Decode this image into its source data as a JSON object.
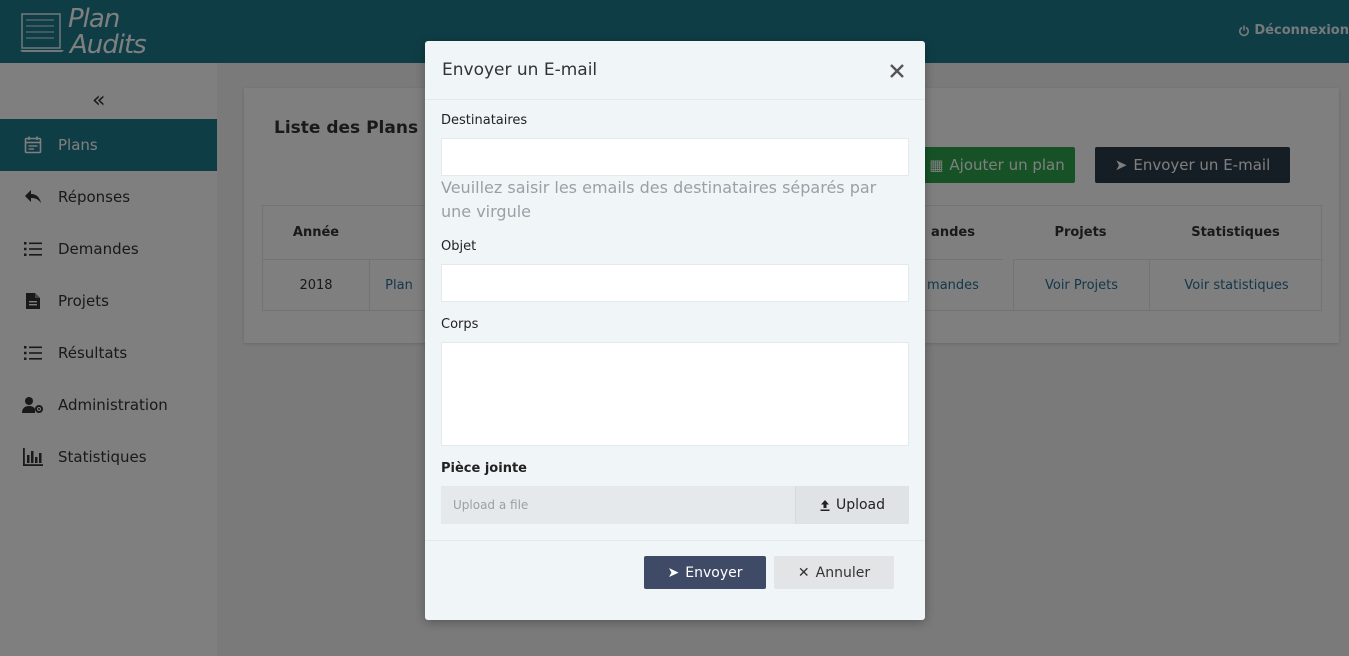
{
  "app": {
    "logo_line1": "Plan",
    "logo_line2": "Audits",
    "logout_label": "Déconnexion"
  },
  "sidebar": {
    "items": [
      {
        "label": "Plans",
        "icon": "calendar-icon",
        "active": true
      },
      {
        "label": "Réponses",
        "icon": "reply-icon",
        "active": false
      },
      {
        "label": "Demandes",
        "icon": "list-icon",
        "active": false
      },
      {
        "label": "Projets",
        "icon": "document-icon",
        "active": false
      },
      {
        "label": "Résultats",
        "icon": "list-icon",
        "active": false
      },
      {
        "label": "Administration",
        "icon": "user-cog-icon",
        "active": false
      },
      {
        "label": "Statistiques",
        "icon": "bar-chart-icon",
        "active": false
      }
    ]
  },
  "main": {
    "title": "Liste des Plans",
    "add_button": "Ajouter un plan",
    "mail_button": "Envoyer un E-mail",
    "table": {
      "headers": [
        "Année",
        "andes",
        "Projets",
        "Statistiques"
      ],
      "row": {
        "year": "2018",
        "plan_link": "Plan",
        "demandes_link": "mandes",
        "projets_link": "Voir Projets",
        "stats_link": "Voir statistiques"
      }
    }
  },
  "modal": {
    "title": "Envoyer un E-mail",
    "recipients_label": "Destinataires",
    "recipients_value": "",
    "recipients_hint": "Veuillez saisir les emails des destinataires séparés par une virgule",
    "subject_label": "Objet",
    "subject_value": "",
    "body_label": "Corps",
    "body_value": "",
    "attachment_label": "Pièce jointe",
    "file_placeholder": "Upload a file",
    "upload_button": "Upload",
    "send_button": "Envoyer",
    "cancel_button": "Annuler"
  },
  "colors": {
    "primary": "#1f7a8c",
    "success": "#2ea44f",
    "dark": "#2b3a4a",
    "send": "#3f4a66"
  }
}
